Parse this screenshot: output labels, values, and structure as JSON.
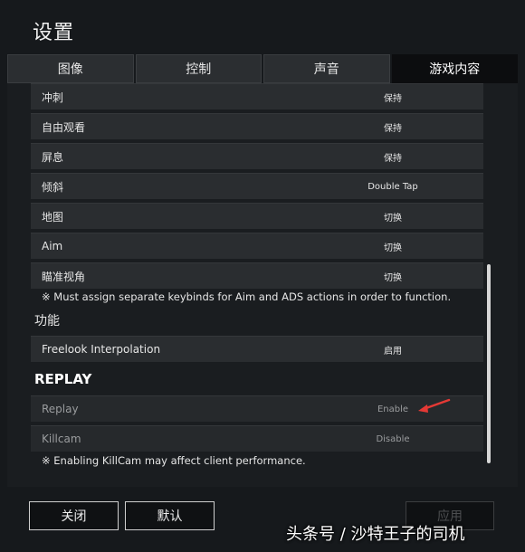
{
  "window": {
    "title": "设置"
  },
  "tabs": [
    {
      "label": "图像"
    },
    {
      "label": "控制"
    },
    {
      "label": "声音"
    },
    {
      "label": "游戏内容",
      "active": true
    }
  ],
  "bindings": [
    {
      "label": "冲刺",
      "value": "保持"
    },
    {
      "label": "自由观看",
      "value": "保持"
    },
    {
      "label": "屏息",
      "value": "保持"
    },
    {
      "label": "倾斜",
      "value": "Double Tap"
    },
    {
      "label": "地图",
      "value": "切换"
    },
    {
      "label": "Aim",
      "value": "切换"
    },
    {
      "label": "瞄准视角",
      "value": "切换"
    }
  ],
  "aim_note": "※ Must assign separate keybinds for Aim and ADS actions in order to function.",
  "functions": {
    "heading": "功能",
    "rows": [
      {
        "label": "Freelook Interpolation",
        "value": "启用"
      }
    ]
  },
  "replay": {
    "heading": "REPLAY",
    "rows": [
      {
        "label": "Replay",
        "value": "Enable"
      },
      {
        "label": "Killcam",
        "value": "Disable"
      }
    ],
    "note": "※ Enabling KillCam may affect client performance."
  },
  "footer": {
    "close_label": "关闭",
    "default_label": "默认",
    "apply_label": "应用"
  },
  "watermark": "头条号 / 沙特王子的司机",
  "colors": {
    "annotation_arrow": "#e53935"
  }
}
